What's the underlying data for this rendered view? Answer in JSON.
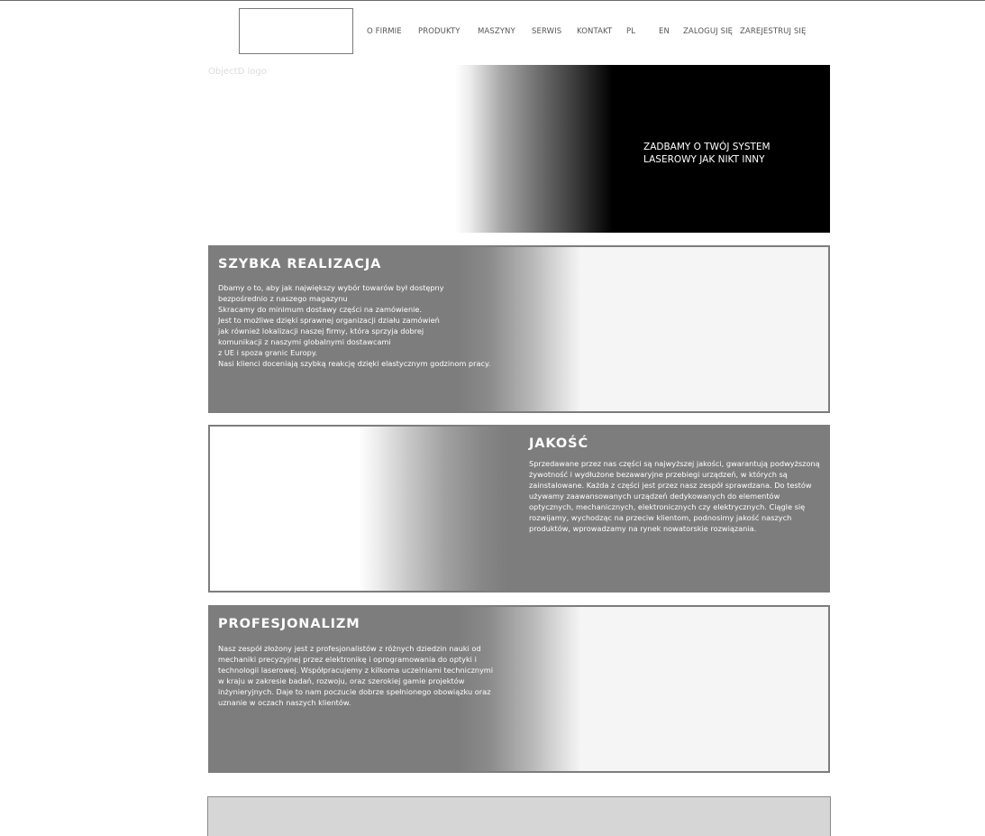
{
  "header": {
    "logo_label": "",
    "nav": [
      "O FIRMIE",
      "PRODUKTY",
      "MASZYNY",
      "SERWIS",
      "KONTAKT",
      "PL",
      "EN",
      "ZALOGUJ SIĘ",
      "ZAREJESTRUJ SIĘ"
    ]
  },
  "logo_alt_text": "ObjectD logo",
  "hero": {
    "text": "ZADBAMY O TWÓJ SYSTEM LASEROWY JAK NIKT INNY"
  },
  "sections": [
    {
      "title": "SZYBKA REALIZACJA",
      "lines": [
        "Dbamy o to, aby jak największy wybór towarów był dostępny",
        "bezpośrednio z naszego magazynu",
        "Skracamy do minimum dostawy części na zamówienie.",
        "Jest to możliwe dzięki sprawnej organizacji działu zamówień",
        "jak również lokalizacji naszej firmy, która sprzyja dobrej",
        "komunikacji z naszymi globalnymi dostawcami",
        "z UE i spoza granic Europy.",
        "Nasi klienci doceniają szybką reakcję dzięki elastycznym godzinom pracy."
      ]
    },
    {
      "title": "JAKOŚĆ",
      "body": "Sprzedawane przez nas części są najwyższej jakości, gwarantują podwyższoną żywotność i wydłużone bezawaryjne przebiegi urządzeń, w których są zainstalowane. Każda z części jest przez nasz zespół sprawdzana. Do testów używamy zaawansowanych urządzeń dedykowanych do elementów optycznych, mechanicznych, elektronicznych czy elektrycznych. Ciągle się rozwijamy, wychodząc na przeciw klientom, podnosimy jakość naszych produktów, wprowadzamy na rynek nowatorskie rozwiązania."
    },
    {
      "title": "PROFESJONALIZM",
      "body": "Nasz zespół złożony jest z profesjonalistów z różnych dziedzin nauki od mechaniki precyzyjnej przez elektronikę i oprogramowania do optyki i technologii laserowej. Współpracujemy z kilkoma uczelniami technicznymi w kraju w zakresie badań, rozwoju, oraz szerokiej gamie projektów inżynieryjnych. Daje to nam poczucie dobrze spełnionego obowiązku oraz uznanie w oczach naszych klientów."
    }
  ]
}
